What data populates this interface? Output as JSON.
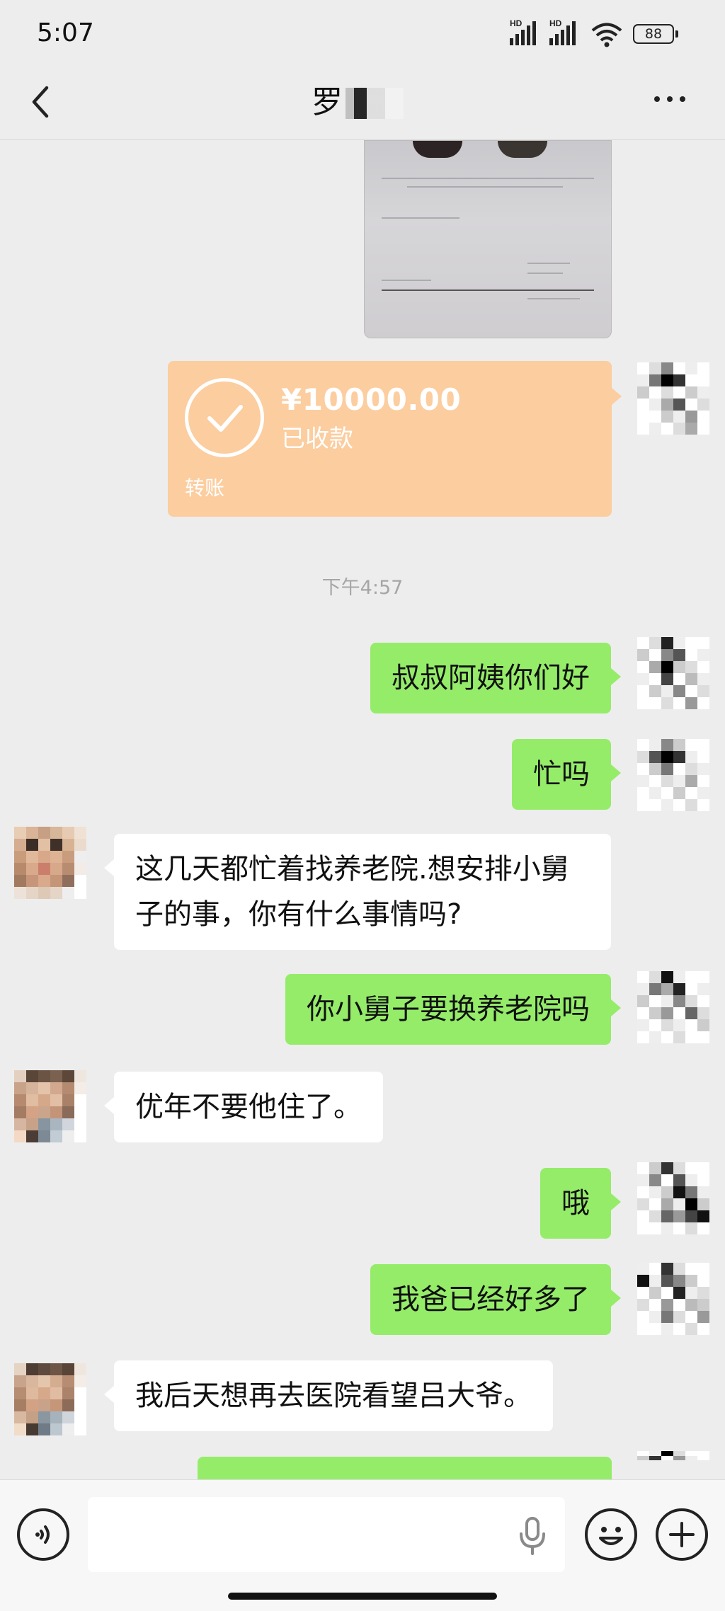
{
  "status_bar": {
    "time": "5:07",
    "signal_1": "HD",
    "signal_2": "HD",
    "battery": "88"
  },
  "header": {
    "title": "罗"
  },
  "messages": {
    "transfer": {
      "amount": "¥10000.00",
      "status": "已收款",
      "label": "转账"
    },
    "timestamp": "下午4:57",
    "m1": "叔叔阿姨你们好",
    "m2": "忙吗",
    "m3": "这几天都忙着找养老院.想安排小舅子的事，你有什么事情吗?",
    "m4": "你小舅子要换养老院吗",
    "m5": "优年不要他住了。",
    "m6": "哦",
    "m7": "我爸已经好多了",
    "m8": "我后天想再去医院看望吕大爷。"
  },
  "colors": {
    "sent_bubble": "#95ec69",
    "received_bubble": "#ffffff",
    "transfer_card": "#fbcd9f",
    "background": "#ededed"
  }
}
